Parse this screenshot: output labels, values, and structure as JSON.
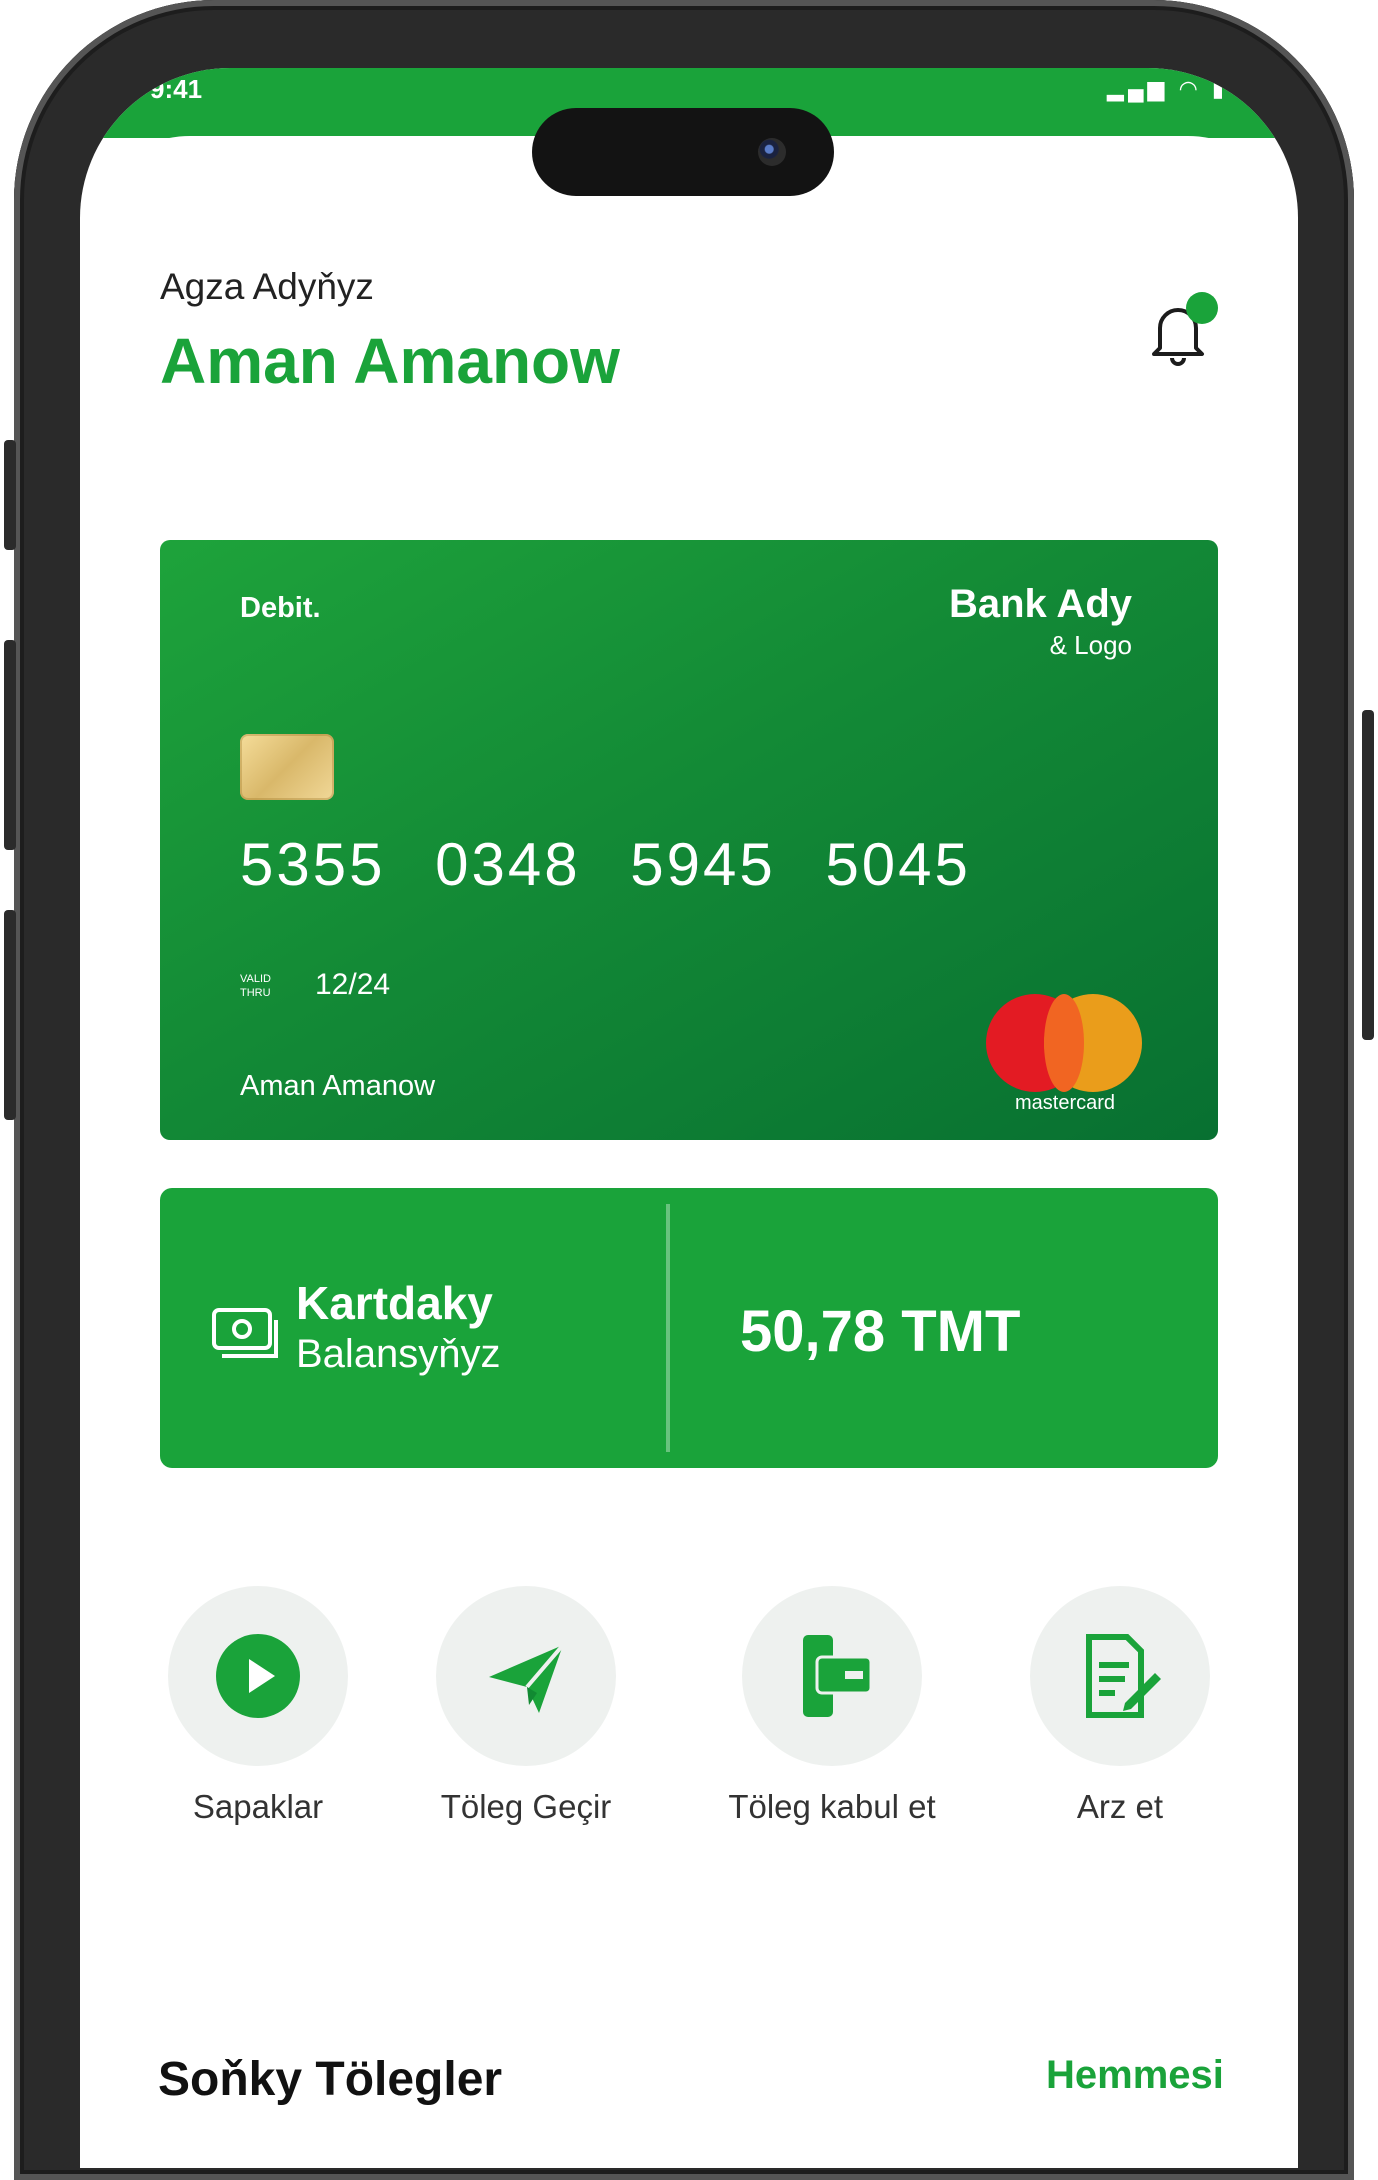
{
  "status": {
    "time": "9:41",
    "icons": "signal wifi battery"
  },
  "header": {
    "greeting": "Agza Adyňyz",
    "name": "Aman Amanow"
  },
  "card": {
    "type": "Debit.",
    "bank_name": "Bank Ady",
    "bank_logo": "& Logo",
    "number": "5355 0348 5945 5045",
    "valid_label": "VALID THRU",
    "valid_date": "12/24",
    "holder": "Aman Amanow",
    "network": "mastercard"
  },
  "balance": {
    "title": "Kartdaky",
    "subtitle": "Balansyňyz",
    "amount": "50,78 TMT"
  },
  "actions": [
    {
      "label": "Sapaklar",
      "icon": "play-icon"
    },
    {
      "label": "Töleg Geçir",
      "icon": "send-icon"
    },
    {
      "label": "Töleg kabul et",
      "icon": "receive-payment-icon"
    },
    {
      "label": "Arz et",
      "icon": "application-edit-icon"
    }
  ],
  "recent": {
    "title": "Soňky Tölegler",
    "see_all": "Hemmesi"
  },
  "colors": {
    "accent": "#1aa33a",
    "card_dark": "#087031"
  }
}
